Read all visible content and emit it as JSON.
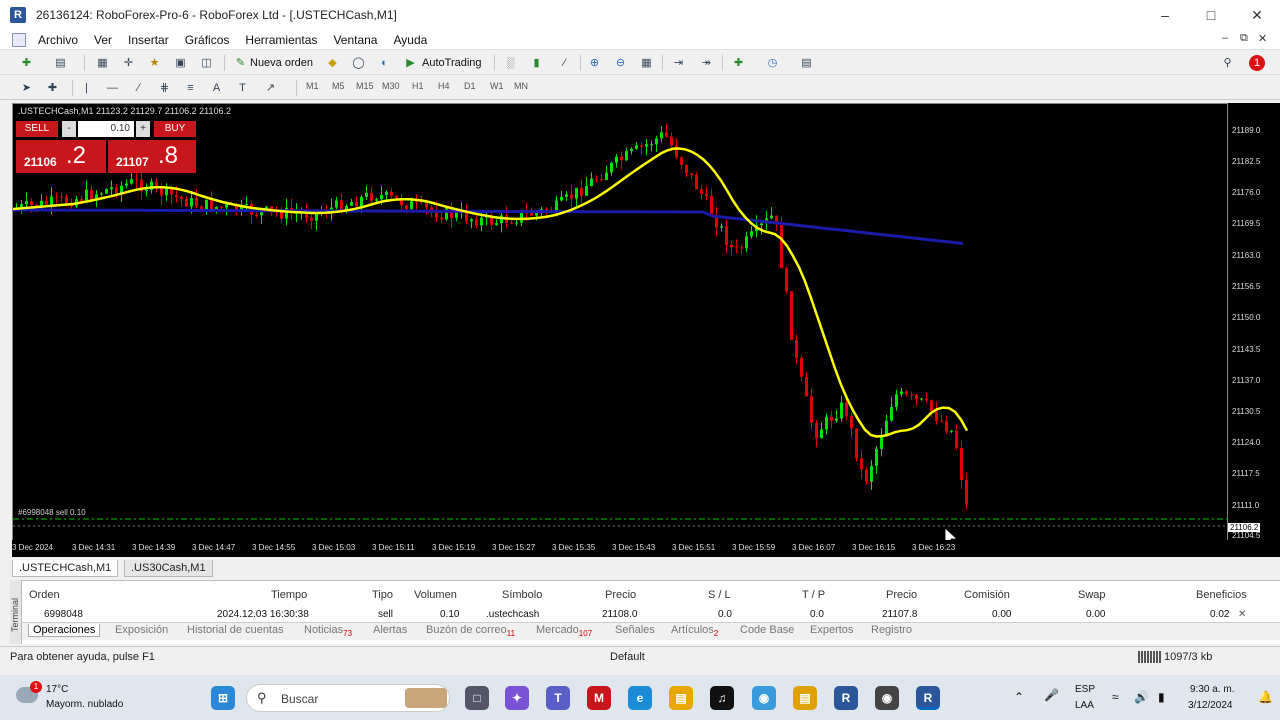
{
  "window": {
    "title": "26136124: RoboForex-Pro-6 - RoboForex Ltd - [.USTECHCash,M1]",
    "app_icon": "metatrader-icon"
  },
  "menu": [
    "Archivo",
    "Ver",
    "Insertar",
    "Gráficos",
    "Herramientas",
    "Ventana",
    "Ayuda"
  ],
  "toolbar": {
    "new_order": "Nueva orden",
    "autotrading": "AutoTrading",
    "notifications_badge": "1"
  },
  "timeframes": [
    "M1",
    "M5",
    "M15",
    "M30",
    "H1",
    "H4",
    "D1",
    "W1",
    "MN"
  ],
  "chart": {
    "symbol_info": ".USTECHCash,M1  21123.2 21129.7 21106.2 21106.2",
    "sell_label": "SELL",
    "buy_label": "BUY",
    "lot": "0.10",
    "sell_price_main": "21106",
    "sell_price_big": ".2",
    "buy_price_main": "21107",
    "buy_price_big": ".8",
    "order_line_label": "#6998048 sell 0.10",
    "current_price_tag": "21106.2",
    "y_labels": [
      "21189.0",
      "21182.5",
      "21176.0",
      "21169.5",
      "21163.0",
      "21156.5",
      "21150.0",
      "21143.5",
      "21137.0",
      "21130.5",
      "21124.0",
      "21117.5",
      "21111.0",
      "21104.5"
    ],
    "x_labels": [
      "3 Dec 2024",
      "3 Dec 14:31",
      "3 Dec 14:39",
      "3 Dec 14:47",
      "3 Dec 14:55",
      "3 Dec 15:03",
      "3 Dec 15:11",
      "3 Dec 15:19",
      "3 Dec 15:27",
      "3 Dec 15:35",
      "3 Dec 15:43",
      "3 Dec 15:51",
      "3 Dec 15:59",
      "3 Dec 16:07",
      "3 Dec 16:15",
      "3 Dec 16:23"
    ],
    "colors": {
      "bull": "#00e000",
      "bear": "#e00000",
      "ma_fast": "#ffff00",
      "ma_slow": "#1a1aa8",
      "order_line": "#00c000"
    }
  },
  "chart_tabs": [
    ".USTECHCash,M1",
    ".US30Cash,M1"
  ],
  "terminal": {
    "side_label": "Terminal",
    "headers": [
      "Orden",
      "Tiempo",
      "Tipo",
      "Volumen",
      "Símbolo",
      "Precio",
      "S / L",
      "T / P",
      "Precio",
      "Comisión",
      "Swap",
      "Beneficios"
    ],
    "row": [
      "6998048",
      "2024.12.03 16:30:38",
      "sell",
      "0.10",
      ".ustechcash",
      "21108.0",
      "0.0",
      "0.0",
      "21107.8",
      "0.00",
      "0.00",
      "0.02"
    ],
    "tabs": [
      {
        "label": "Operaciones",
        "count": ""
      },
      {
        "label": "Exposición",
        "count": ""
      },
      {
        "label": "Historial de cuentas",
        "count": ""
      },
      {
        "label": "Noticias",
        "count": "73"
      },
      {
        "label": "Alertas",
        "count": ""
      },
      {
        "label": "Buzón de correo",
        "count": "11"
      },
      {
        "label": "Mercado",
        "count": "107"
      },
      {
        "label": "Señales",
        "count": ""
      },
      {
        "label": "Artículos",
        "count": "2"
      },
      {
        "label": "Code Base",
        "count": ""
      },
      {
        "label": "Expertos",
        "count": ""
      },
      {
        "label": "Registro",
        "count": ""
      }
    ]
  },
  "status": {
    "help": "Para obtener ayuda, pulse F1",
    "profile": "Default",
    "traffic": "1097/3 kb"
  },
  "taskbar": {
    "weather_temp": "17°C",
    "weather_desc": "Mayorm. nublado",
    "weather_badge": "1",
    "search_placeholder": "Buscar",
    "lang1": "ESP",
    "lang2": "LAA",
    "time": "9:30 a. m.",
    "date": "3/12/2024"
  }
}
